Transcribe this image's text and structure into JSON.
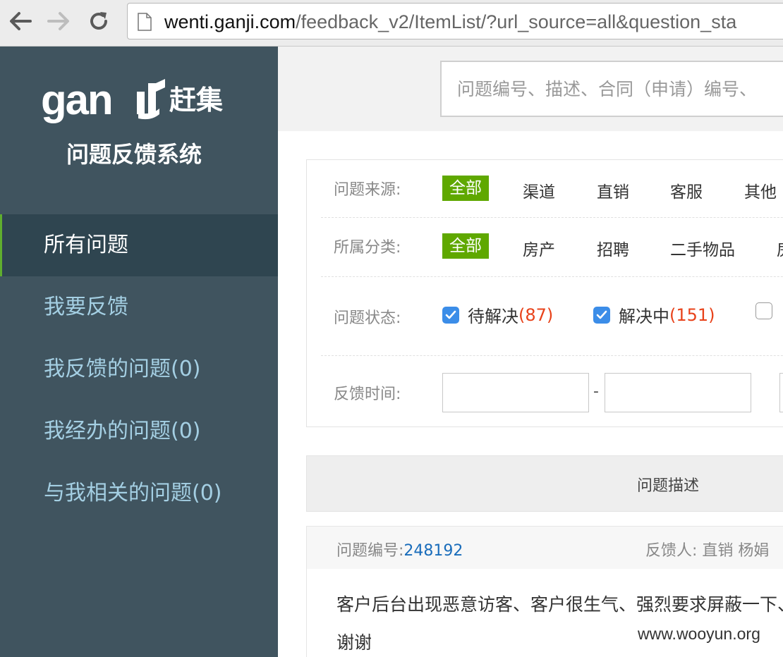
{
  "browser": {
    "url_host": "wenti.ganji.com",
    "url_path": "/feedback_v2/ItemList/?url_source=all&question_sta"
  },
  "sidebar": {
    "logo_text": "gan",
    "logo_cn": "赶集",
    "system_title": "问题反馈系统",
    "items": [
      {
        "label": "所有问题",
        "active": true
      },
      {
        "label": "我要反馈",
        "active": false
      },
      {
        "label": "我反馈的问题(0)",
        "active": false
      },
      {
        "label": "我经办的问题(0)",
        "active": false
      },
      {
        "label": "与我相关的问题(0)",
        "active": false
      }
    ]
  },
  "search": {
    "placeholder": "问题编号、描述、合同（申请）编号、"
  },
  "filters": {
    "source": {
      "label": "问题来源:",
      "options": [
        "全部",
        "渠道",
        "直销",
        "客服",
        "其他"
      ],
      "selected": "全部"
    },
    "category": {
      "label": "所属分类:",
      "options": [
        "全部",
        "房产",
        "招聘",
        "二手物品",
        "房"
      ],
      "selected": "全部"
    },
    "status": {
      "label": "问题状态:",
      "items": [
        {
          "label": "待解决",
          "count": "(87)",
          "checked": true
        },
        {
          "label": "解决中",
          "count": "(151)",
          "checked": true
        },
        {
          "label": "",
          "count": "",
          "checked": false
        }
      ]
    },
    "time": {
      "label": "反馈时间:",
      "separator": "-"
    }
  },
  "table": {
    "header_desc": "问题描述"
  },
  "issue": {
    "id_label": "问题编号:",
    "id": "248192",
    "reporter": "反馈人: 直销 杨娟",
    "text": "客户后台出现恶意访客、客户很生气、强烈要求屏蔽一下、谢谢"
  },
  "watermark": "www.wooyun.org",
  "colors": {
    "sidebar_bg": "#40545f",
    "sidebar_active": "#2f4550",
    "sidebar_link": "#a4cfe3",
    "selected_green": "#5fa800",
    "count_red": "#e8421a",
    "link_blue": "#1a6dbb",
    "checkbox_blue": "#3b8de8"
  }
}
